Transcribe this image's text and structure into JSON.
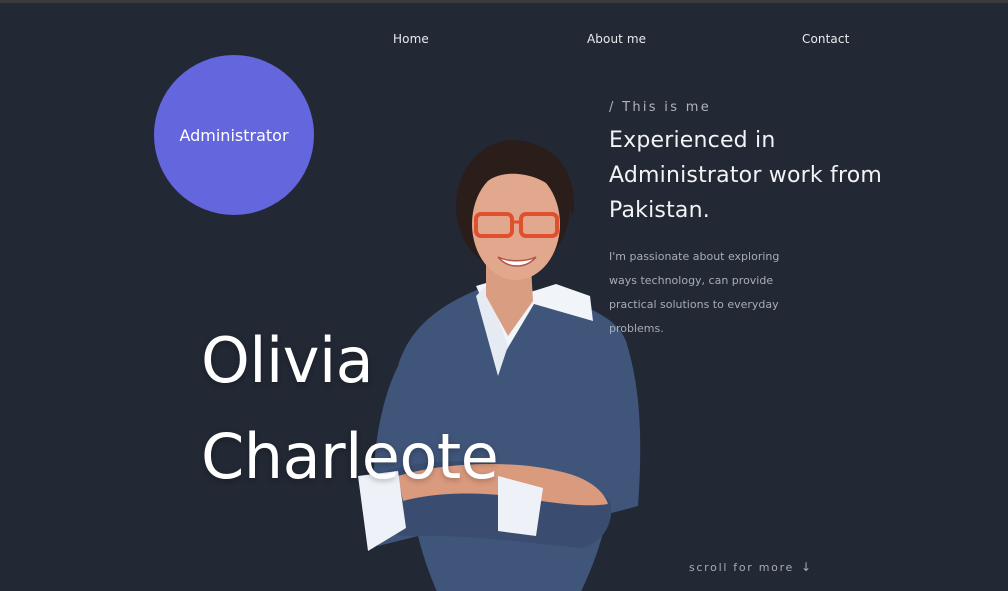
{
  "nav": {
    "home": "Home",
    "about": "About me",
    "contact": "Contact"
  },
  "role": {
    "label": "Administrator"
  },
  "name": {
    "first": "Olivia",
    "last": "Charleote"
  },
  "intro": {
    "eyebrow": "/ This is me",
    "heading": "Experienced in Administrator work from Pakistan.",
    "description": "I'm passionate about exploring ways technology, can provide practical solutions to everyday problems."
  },
  "scroll": {
    "label": "scroll for more",
    "icon": "arrow-down-icon"
  },
  "colors": {
    "background": "#222834",
    "accent": "#6466dd",
    "text": "#ffffff",
    "muted": "#a7acb8"
  }
}
